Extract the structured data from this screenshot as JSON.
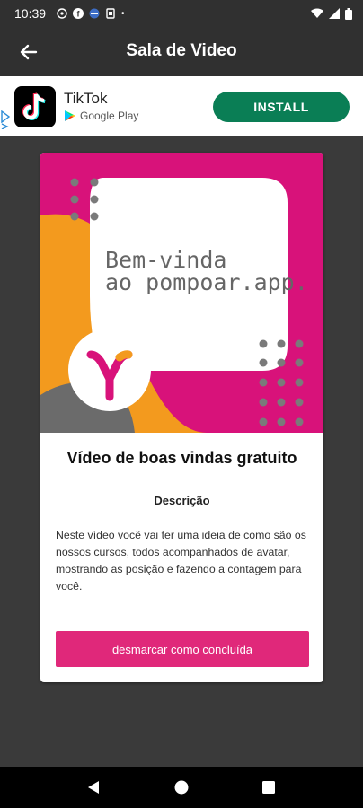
{
  "status_bar": {
    "time": "10:39",
    "dot": "•",
    "icons": [
      "cast-icon",
      "f-icon",
      "globe-icon",
      "clipboard-icon"
    ],
    "right_icons": [
      "wifi-icon",
      "signal-icon",
      "battery-icon"
    ]
  },
  "app_bar": {
    "title": "Sala de Video"
  },
  "ad": {
    "app_name": "TikTok",
    "store": "Google Play",
    "install_label": "INSTALL",
    "install_color": "#0a7e55"
  },
  "card": {
    "hero": {
      "headline_line1": "Bem-vinda",
      "headline_line2": "ao pompoar.app.",
      "logo_letter": "Y",
      "colors": {
        "magenta": "#d8127a",
        "orange": "#f39a1e",
        "gray": "#6b6b6b"
      }
    },
    "title": "Vídeo de boas vindas gratuito",
    "description_label": "Descrição",
    "description": "Neste vídeo você vai ter uma ideia de como são os nossos cursos, todos acompanhados de avatar, mostrando as posição e fazendo a contagem para você.",
    "button_label": "desmarcar como concluída",
    "button_color": "#e0287a"
  },
  "nav_bar": {
    "buttons": [
      "back-triangle-icon",
      "home-circle-icon",
      "recents-square-icon"
    ]
  }
}
